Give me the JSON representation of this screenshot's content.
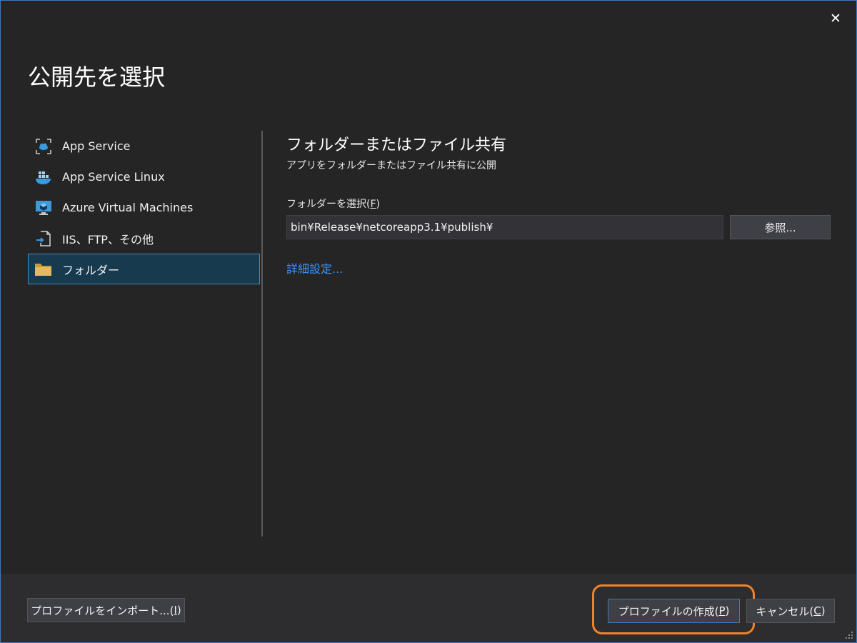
{
  "dialog": {
    "title": "公開先を選択",
    "close_symbol": "✕"
  },
  "sidebar": {
    "items": [
      {
        "label": "App Service",
        "icon": "app-service-icon"
      },
      {
        "label": "App Service Linux",
        "icon": "app-service-linux-icon"
      },
      {
        "label": "Azure Virtual Machines",
        "icon": "virtual-machine-icon"
      },
      {
        "label": "IIS、FTP、その他",
        "icon": "iis-ftp-icon"
      },
      {
        "label": "フォルダー",
        "icon": "folder-icon",
        "selected": true
      }
    ]
  },
  "content": {
    "title": "フォルダーまたはファイル共有",
    "subtitle": "アプリをフォルダーまたはファイル共有に公開",
    "folder_label_prefix": "フォルダーを選択(",
    "folder_label_key": "F",
    "folder_label_suffix": ")",
    "folder_path": "bin¥Release¥netcoreapp3.1¥publish¥",
    "browse_label": "参照...",
    "advanced_link": "詳細設定..."
  },
  "footer": {
    "import_prefix": "プロファイルをインポート...(",
    "import_key": "I",
    "import_suffix": ")",
    "create_prefix": "プロファイルの作成(",
    "create_key": "P",
    "create_suffix": ")",
    "cancel_prefix": "キャンセル(",
    "cancel_key": "C",
    "cancel_suffix": ")"
  },
  "colors": {
    "background": "#252526",
    "footer": "#2d2d30",
    "selection": "#173a4e",
    "accent": "#3c7ab8",
    "link": "#3794ff",
    "highlight_ring": "#f08328"
  }
}
